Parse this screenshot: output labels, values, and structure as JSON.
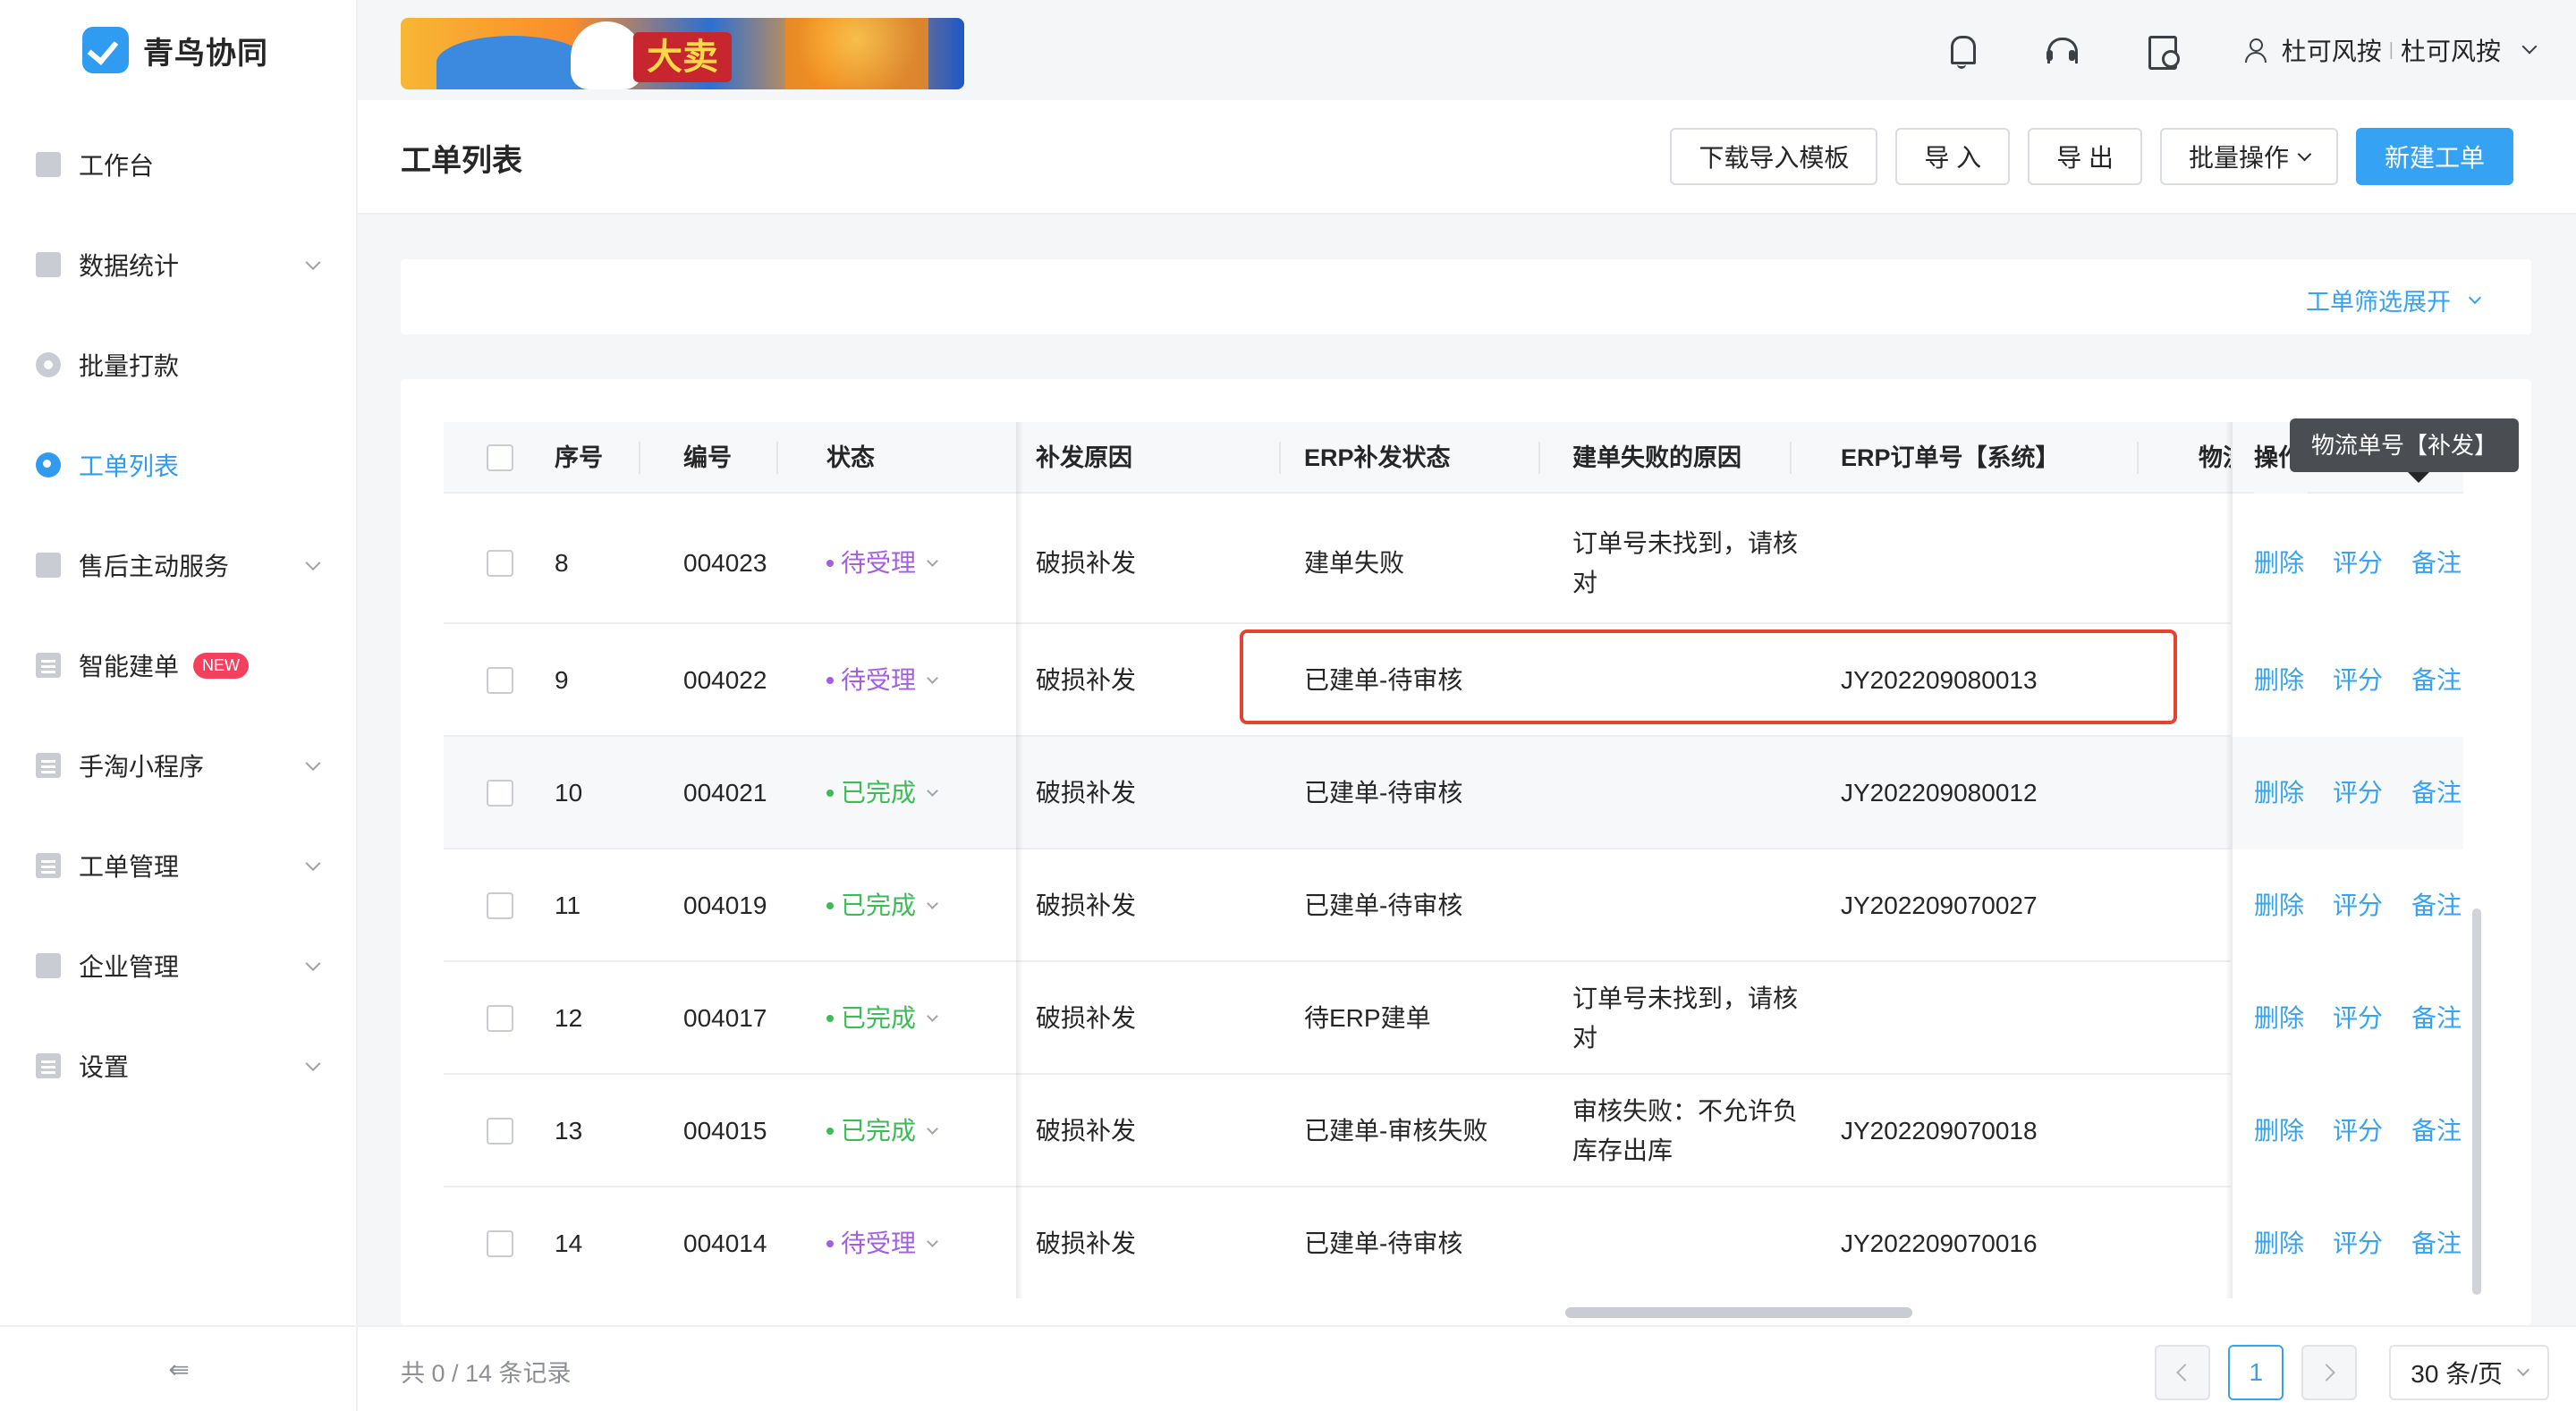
{
  "app": {
    "name": "青鸟协同"
  },
  "sidebar": {
    "items": [
      {
        "label": "工作台",
        "icon": "monitor-icon",
        "expandable": false,
        "active": false
      },
      {
        "label": "数据统计",
        "icon": "bar-chart-icon",
        "expandable": true,
        "active": false
      },
      {
        "label": "批量打款",
        "icon": "payment-icon",
        "expandable": false,
        "active": false
      },
      {
        "label": "工单列表",
        "icon": "search-icon",
        "expandable": false,
        "active": true
      },
      {
        "label": "售后主动服务",
        "icon": "service-icon",
        "expandable": true,
        "active": false
      },
      {
        "label": "智能建单",
        "icon": "document-icon",
        "expandable": false,
        "active": false,
        "badge": "NEW"
      },
      {
        "label": "手淘小程序",
        "icon": "phone-icon",
        "expandable": true,
        "active": false
      },
      {
        "label": "工单管理",
        "icon": "order-icon",
        "expandable": true,
        "active": false
      },
      {
        "label": "企业管理",
        "icon": "building-icon",
        "expandable": true,
        "active": false
      },
      {
        "label": "设置",
        "icon": "settings-icon",
        "expandable": true,
        "active": false
      }
    ],
    "collapse_icon": "collapse-menu-icon"
  },
  "topbar": {
    "banner_text": "大卖",
    "user": {
      "shop": "杜可风按",
      "name": "杜可风按"
    },
    "icons": [
      "bell-icon",
      "headset-icon",
      "calendar-clock-icon",
      "user-icon"
    ]
  },
  "header": {
    "title": "工单列表",
    "actions": [
      "下载导入模板",
      "导 入",
      "导 出",
      "批量操作",
      "新建工单"
    ]
  },
  "filter": {
    "toggle_label": "工单筛选展开"
  },
  "table": {
    "columns": [
      "序号",
      "编号",
      "状态",
      "补发原因",
      "ERP补发状态",
      "建单失败的原因",
      "ERP订单号【系统】",
      "物流",
      "操作"
    ],
    "rows": [
      {
        "seq": "8",
        "code": "004023",
        "status": "待受理",
        "reason": "破损补发",
        "erp_status": "建单失败",
        "fail_reason": "订单号未找到，请核对",
        "erp_order": ""
      },
      {
        "seq": "9",
        "code": "004022",
        "status": "待受理",
        "reason": "破损补发",
        "erp_status": "已建单-待审核",
        "fail_reason": "",
        "erp_order": "JY202209080013"
      },
      {
        "seq": "10",
        "code": "004021",
        "status": "已完成",
        "reason": "破损补发",
        "erp_status": "已建单-待审核",
        "fail_reason": "",
        "erp_order": "JY202209080012"
      },
      {
        "seq": "11",
        "code": "004019",
        "status": "已完成",
        "reason": "破损补发",
        "erp_status": "已建单-待审核",
        "fail_reason": "",
        "erp_order": "JY202209070027"
      },
      {
        "seq": "12",
        "code": "004017",
        "status": "已完成",
        "reason": "破损补发",
        "erp_status": "待ERP建单",
        "fail_reason": "订单号未找到，请核对",
        "erp_order": ""
      },
      {
        "seq": "13",
        "code": "004015",
        "status": "已完成",
        "reason": "破损补发",
        "erp_status": "已建单-审核失败",
        "fail_reason": "审核失败：不允许负库存出库",
        "erp_order": "JY202209070018"
      },
      {
        "seq": "14",
        "code": "004014",
        "status": "待受理",
        "reason": "破损补发",
        "erp_status": "已建单-待审核",
        "fail_reason": "",
        "erp_order": "JY202209070016"
      }
    ],
    "row_actions": [
      "删除",
      "评分",
      "备注"
    ],
    "status_colors": {
      "待受理": "#a45ee5",
      "已完成": "#3dbb56"
    },
    "tooltip": "物流单号【补发】"
  },
  "footer": {
    "total": "共 0 / 14 条记录",
    "current_page": "1",
    "page_size": "30 条/页"
  },
  "colors": {
    "accent": "#36a2f4",
    "highlight_border": "#e8412f"
  }
}
